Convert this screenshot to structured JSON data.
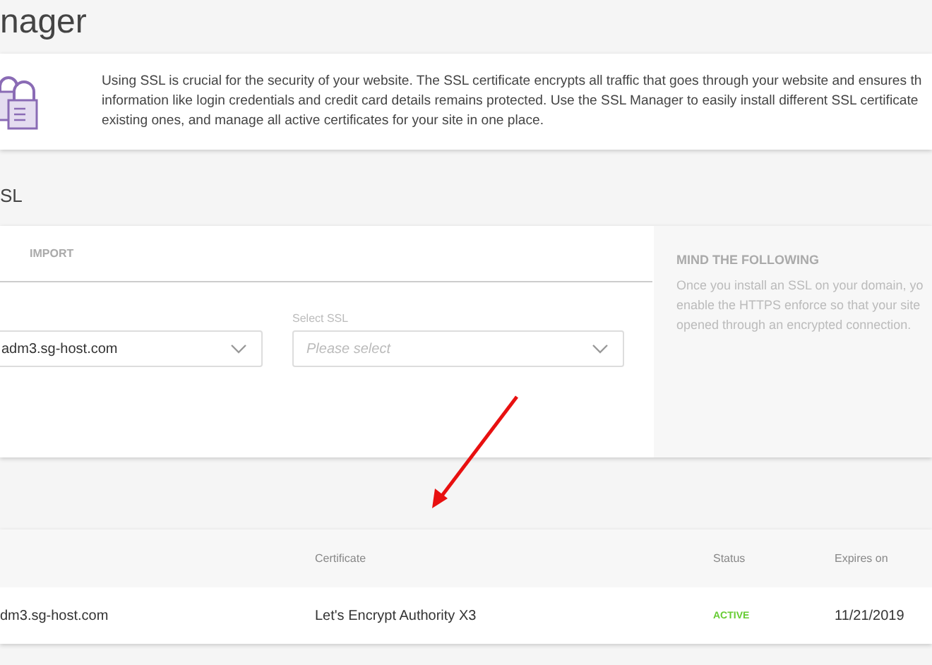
{
  "page_title": "nager",
  "info": {
    "lines": [
      "Using SSL is crucial for the security of your website. The SSL certificate encrypts all traffic that goes through your website and ensures th",
      "information like login credentials and credit card details remains protected. Use the SSL Manager to easily install different SSL certificate",
      "existing ones, and manage all active certificates for your site in one place."
    ]
  },
  "section_title": "SL",
  "tabs": [
    {
      "label": "IMPORT",
      "selected": false
    }
  ],
  "fields": [
    {
      "value": "adm3.sg-host.com"
    },
    {
      "label": "Select SSL",
      "placeholder": "Please select"
    }
  ],
  "notice": {
    "title": "MIND THE FOLLOWING",
    "lines": [
      "Once you install an SSL on your domain, yo",
      "enable the HTTPS enforce so that your site",
      "opened through an encrypted connection."
    ]
  },
  "table": {
    "columns": [
      "Certificate",
      "Status",
      "Expires on"
    ],
    "rows": [
      {
        "domain": "dm3.sg-host.com",
        "certificate": "Let's Encrypt Authority X3",
        "status": "ACTIVE",
        "expires": "11/21/2019"
      }
    ]
  }
}
